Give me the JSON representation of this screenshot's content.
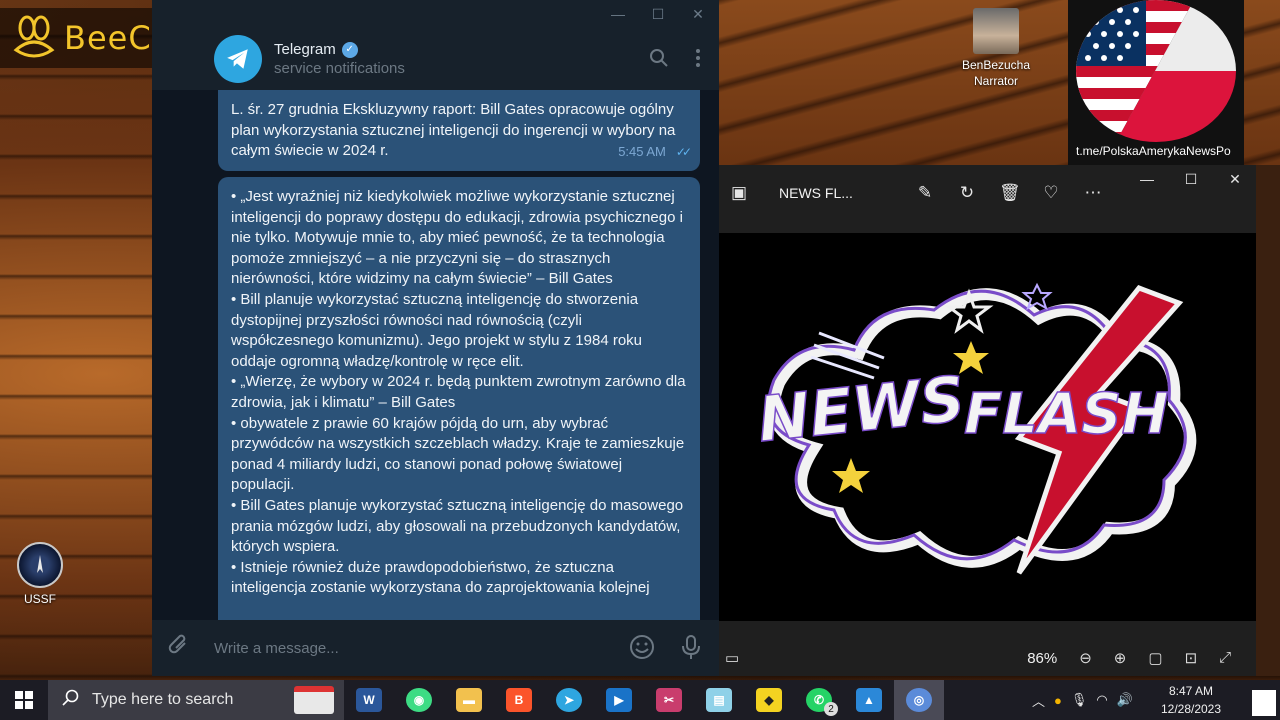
{
  "watermark": {
    "brand": "BeeCut"
  },
  "desktop_icons": {
    "narrator": {
      "name": "BenBezucha",
      "subtitle": "Narrator"
    },
    "ussf": {
      "label": "USSF"
    }
  },
  "flag_card": {
    "caption": "t.me/PolskaAmerykaNewsPo"
  },
  "telegram": {
    "channel_name": "Telegram",
    "channel_status": "service notifications",
    "message1": {
      "text": "L. śr. 27 grudnia Ekskluzywny raport: Bill Gates opracowuje ogólny plan wykorzystania sztucznej inteligencji do ingerencji w wybory na całym świecie w 2024 r.",
      "time": "5:45 AM"
    },
    "message2": {
      "paragraphs": [
        "•  „Jest wyraźniej niż kiedykolwiek możliwe wykorzystanie sztucznej inteligencji do poprawy dostępu do edukacji, zdrowia psychicznego i nie tylko. Motywuje mnie to, aby mieć pewność, że ta technologia pomoże zmniejszyć – a nie przyczyni się – do strasznych nierówności, które widzimy na całym świecie” – Bill Gates",
        "•  Bill planuje wykorzystać sztuczną inteligencję do stworzenia dystopijnej przyszłości równości nad równością (czyli współczesnego komunizmu). Jego projekt w stylu z 1984 roku oddaje ogromną władzę/kontrolę w ręce elit.",
        "•  „Wierzę, że wybory w 2024 r. będą punktem zwrotnym zarówno dla zdrowia, jak i klimatu” – Bill Gates",
        "•  obywatele z prawie 60 krajów pójdą do urn, aby wybrać przywódców na wszystkich szczeblach władzy. Kraje te zamieszkuje ponad 4 miliardy ludzi, co stanowi ponad połowę światowej populacji.",
        "•  Bill Gates planuje wykorzystać sztuczną inteligencję do masowego prania mózgów ludzi, aby głosowali na przebudzonych kandydatów, których wspiera.",
        "•  Istnieje również duże prawdopodobieństwo, że sztuczna inteligencja zostanie wykorzystana do zaprojektowania kolejnej"
      ]
    },
    "input_placeholder": "Write a message..."
  },
  "photos": {
    "file_title": "NEWS FL...",
    "image_text_1": "NEWS",
    "image_text_2": "FLASH",
    "zoom": "86%"
  },
  "taskbar": {
    "search_placeholder": "Type here to search",
    "whatsapp_badge": "2",
    "time": "8:47 AM",
    "date": "12/28/2023"
  },
  "colors": {
    "telegram_bg": "#0e1621",
    "bubble": "#2b5278",
    "accent": "#2ea6e0",
    "beecut_yellow": "#f3c52b"
  }
}
